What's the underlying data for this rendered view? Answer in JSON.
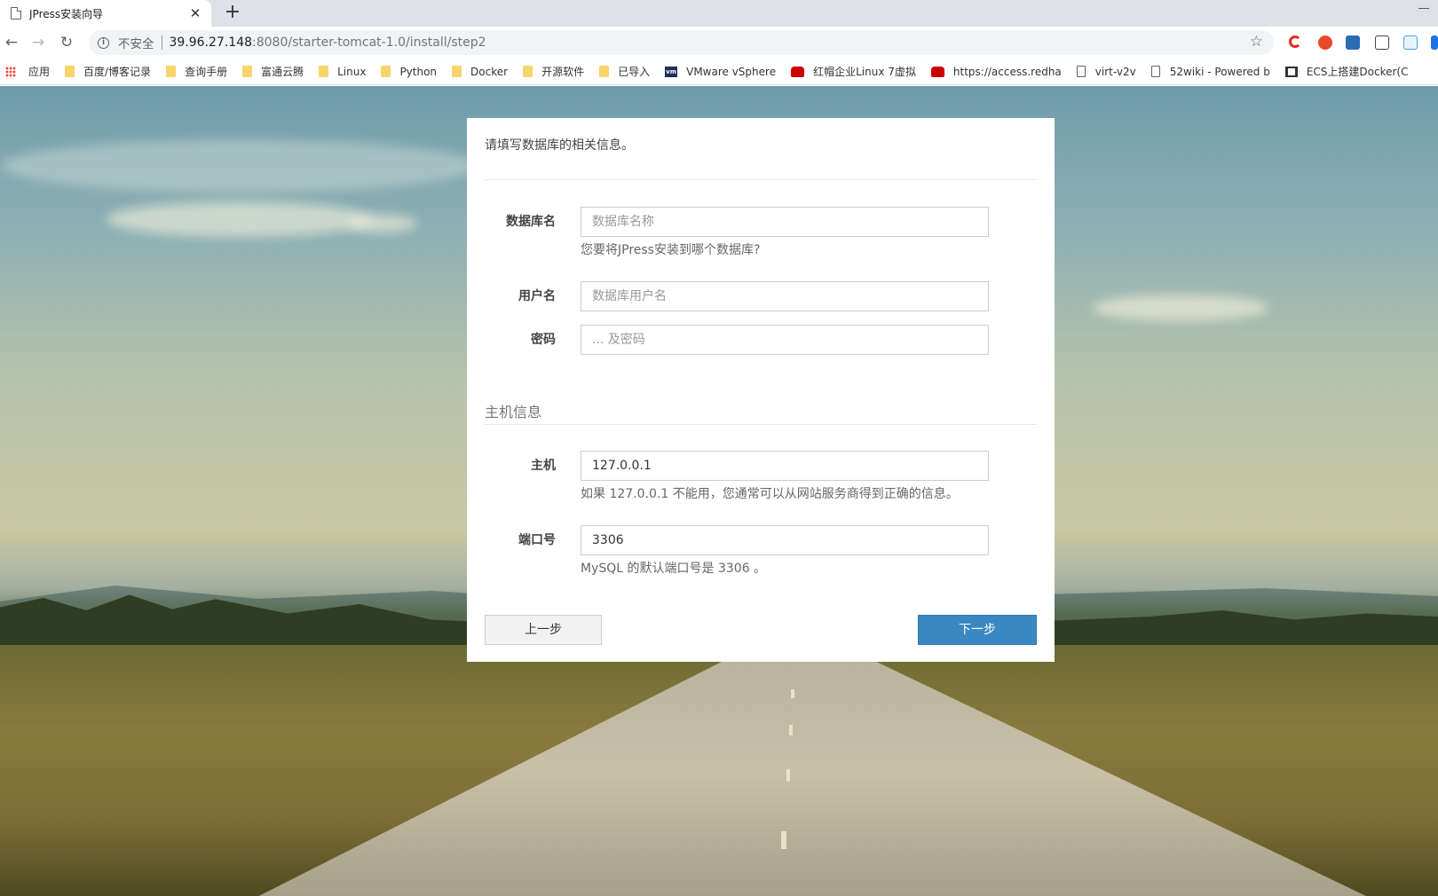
{
  "browser": {
    "tab_title": "JPress安装向导",
    "new_tab": "+",
    "insecure_label": "不安全",
    "url_host": "39.96.27.148",
    "url_rest": ":8080/starter-tomcat-1.0/install/step2",
    "star_icon": "☆"
  },
  "bookmarks": [
    {
      "label": "应用",
      "icon": "apps-grid-icon"
    },
    {
      "label": "百度/博客记录",
      "icon": "folder-icon"
    },
    {
      "label": "查询手册",
      "icon": "folder-icon"
    },
    {
      "label": "富通云腾",
      "icon": "folder-icon"
    },
    {
      "label": "Linux",
      "icon": "folder-icon"
    },
    {
      "label": "Python",
      "icon": "folder-icon"
    },
    {
      "label": "Docker",
      "icon": "folder-icon"
    },
    {
      "label": "开源软件",
      "icon": "folder-icon"
    },
    {
      "label": "已导入",
      "icon": "folder-icon"
    },
    {
      "label": "VMware vSphere",
      "icon": "vmware-icon"
    },
    {
      "label": "红帽企业Linux 7虚拟",
      "icon": "redhat-icon"
    },
    {
      "label": "https://access.redha",
      "icon": "redhat-icon"
    },
    {
      "label": "virt-v2v",
      "icon": "page-icon"
    },
    {
      "label": "52wiki - Powered b",
      "icon": "page-icon"
    },
    {
      "label": "ECS上搭建Docker(C",
      "icon": "ecs-icon"
    }
  ],
  "form": {
    "intro": "请填写数据库的相关信息。",
    "db_name": {
      "label": "数据库名",
      "placeholder": "数据库名称",
      "value": "",
      "hint": "您要将JPress安装到哪个数据库?"
    },
    "username": {
      "label": "用户名",
      "placeholder": "数据库用户名",
      "value": ""
    },
    "password": {
      "label": "密码",
      "placeholder": "... 及密码",
      "value": ""
    },
    "host_section_title": "主机信息",
    "host": {
      "label": "主机",
      "value": "127.0.0.1",
      "hint": "如果 127.0.0.1 不能用，您通常可以从网站服务商得到正确的信息。"
    },
    "port": {
      "label": "端口号",
      "value": "3306",
      "hint": "MySQL 的默认端口号是 3306 。"
    },
    "prev_button": "上一步",
    "next_button": "下一步"
  },
  "colors": {
    "next_button_bg": "#3a87c2",
    "chrome_tabstrip": "#dee1e6"
  }
}
